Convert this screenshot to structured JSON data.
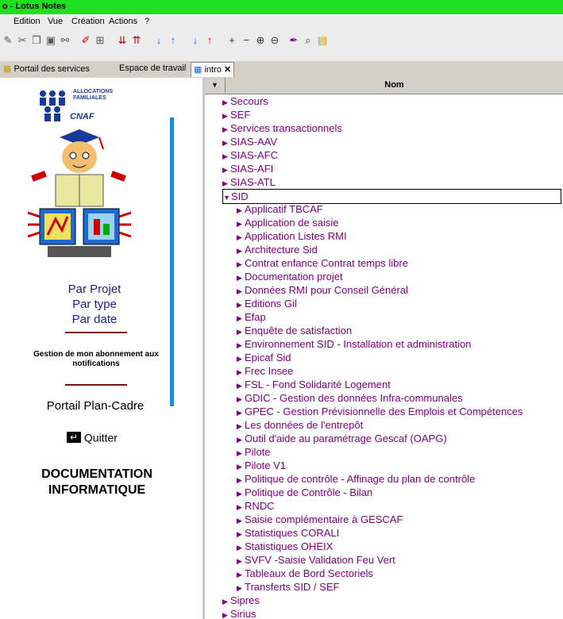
{
  "window": {
    "title": "o - Lotus Notes"
  },
  "menu": {
    "items": [
      "Edition",
      "Vue",
      "Création",
      "Actions",
      "?"
    ]
  },
  "tabs": {
    "items": [
      "Portail des services",
      "Espace de travail",
      "intro"
    ]
  },
  "colors": {
    "titlebar": "#1ee01e",
    "link_purple": "#800080",
    "link_blue": "#1a1a9a",
    "accent_blue": "#1e8cd0"
  },
  "left": {
    "logo_line1": "ALLOCATIONS",
    "logo_line2": "FAMILIALES",
    "logo_line3": "CNAF",
    "links": [
      "Par Projet",
      "Par type",
      "Par date"
    ],
    "notif_text": "Gestion de mon abonnement aux notifications",
    "plan": "Portail Plan-Cadre",
    "quit": "Quitter",
    "doc_line1": "DOCUMENTATION",
    "doc_line2": "INFORMATIQUE"
  },
  "view": {
    "header_name": "Nom",
    "rows": [
      {
        "label": "Secours",
        "level": 0,
        "open": false
      },
      {
        "label": "SEF",
        "level": 0,
        "open": false
      },
      {
        "label": "Services transactionnels",
        "level": 0,
        "open": false
      },
      {
        "label": "SIAS-AAV",
        "level": 0,
        "open": false
      },
      {
        "label": "SIAS-AFC",
        "level": 0,
        "open": false
      },
      {
        "label": "SIAS-AFI",
        "level": 0,
        "open": false
      },
      {
        "label": "SIAS-ATL",
        "level": 0,
        "open": false
      },
      {
        "label": "SID",
        "level": 0,
        "open": true
      },
      {
        "label": "Applicatif TBCAF",
        "level": 1,
        "open": false
      },
      {
        "label": "Application de saisie",
        "level": 1,
        "open": false
      },
      {
        "label": "Application Listes RMI",
        "level": 1,
        "open": false
      },
      {
        "label": "Architecture Sid",
        "level": 1,
        "open": false
      },
      {
        "label": "Contrat enfance Contrat temps libre",
        "level": 1,
        "open": false
      },
      {
        "label": "Documentation projet",
        "level": 1,
        "open": false
      },
      {
        "label": "Données RMI pour Conseil Général",
        "level": 1,
        "open": false
      },
      {
        "label": "Editions Gil",
        "level": 1,
        "open": false
      },
      {
        "label": "Efap",
        "level": 1,
        "open": false
      },
      {
        "label": "Enquête de satisfaction",
        "level": 1,
        "open": false
      },
      {
        "label": "Environnement SID - Installation et administration",
        "level": 1,
        "open": false
      },
      {
        "label": "Epicaf Sid",
        "level": 1,
        "open": false
      },
      {
        "label": "Frec Insee",
        "level": 1,
        "open": false
      },
      {
        "label": "FSL - Fond Solidarité Logement",
        "level": 1,
        "open": false
      },
      {
        "label": "GDIC - Gestion des données Infra-communales",
        "level": 1,
        "open": false
      },
      {
        "label": "GPEC - Gestion Prévisionnelle des Emplois et Compétences",
        "level": 1,
        "open": false
      },
      {
        "label": "Les données de l'entrepôt",
        "level": 1,
        "open": false
      },
      {
        "label": "Outil d'aide au paramétrage Gescaf (OAPG)",
        "level": 1,
        "open": false
      },
      {
        "label": "Pilote",
        "level": 1,
        "open": false
      },
      {
        "label": "Pilote V1",
        "level": 1,
        "open": false
      },
      {
        "label": "Politique de contrôle - Affinage du plan de contrôle",
        "level": 1,
        "open": false
      },
      {
        "label": "Politique de Contrôle - Bilan",
        "level": 1,
        "open": false
      },
      {
        "label": "RNDC",
        "level": 1,
        "open": false
      },
      {
        "label": "Saisie complémentaire à GESCAF",
        "level": 1,
        "open": false
      },
      {
        "label": "Statistiques CORALI",
        "level": 1,
        "open": false
      },
      {
        "label": "Statistiques OHEIX",
        "level": 1,
        "open": false
      },
      {
        "label": "SVFV -Saisie Validation Feu Vert",
        "level": 1,
        "open": false
      },
      {
        "label": "Tableaux de Bord Sectoriels",
        "level": 1,
        "open": false
      },
      {
        "label": "Transferts SID / SEF",
        "level": 1,
        "open": false
      },
      {
        "label": "Sipres",
        "level": 0,
        "open": false
      },
      {
        "label": "Sirius",
        "level": 0,
        "open": false
      }
    ]
  }
}
